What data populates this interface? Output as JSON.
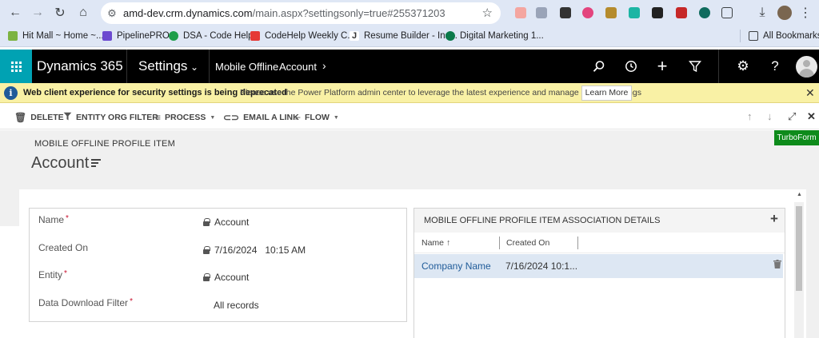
{
  "browser": {
    "url_host": "amd-dev.crm.dynamics.com",
    "url_path": "/main.aspx?settingsonly=true#255371203",
    "bookmarks": [
      {
        "label": "Hit Mall ~ Home ~...",
        "color": "#7cb342"
      },
      {
        "label": "PipelinePRO",
        "color": "#6c4ad0"
      },
      {
        "label": "DSA - Code Help",
        "color": "#1e9e4a"
      },
      {
        "label": "CodeHelp Weekly C...",
        "color": "#e53935"
      },
      {
        "label": "Resume Builder - Ins...",
        "color": "#333333"
      },
      {
        "label": "Digital Marketing 1...",
        "color": "#0b7a4b"
      }
    ],
    "all_bookmarks": "All Bookmarks"
  },
  "navbar": {
    "app_name": "Dynamics 365",
    "area": "Settings",
    "crumb_area": "Mobile Offline",
    "crumb_entity": "Account"
  },
  "notification": {
    "title": "Web client experience for security settings is being deprecated",
    "message": "Please use the Power Platform admin center to leverage the latest experience and manage security settings",
    "button": "Learn More"
  },
  "commands": {
    "delete": "DELETE",
    "entity_org_filter": "ENTITY ORG FILTER",
    "process": "PROCESS",
    "email_link": "EMAIL A LINK",
    "flow": "FLOW"
  },
  "header": {
    "entity_label": "MOBILE OFFLINE PROFILE ITEM",
    "record_title": "Account",
    "turboform": "TurboForm"
  },
  "fields": [
    {
      "label": "Name",
      "required": true,
      "value": "Account",
      "locked": true
    },
    {
      "label": "Created On",
      "required": false,
      "value": "7/16/2024   10:15 AM",
      "locked": true
    },
    {
      "label": "Entity",
      "required": true,
      "value": "Account",
      "locked": true
    },
    {
      "label": "Data Download Filter",
      "required": true,
      "value": "All records",
      "locked": false
    }
  ],
  "subgrid": {
    "title": "MOBILE OFFLINE PROFILE ITEM ASSOCIATION DETAILS",
    "columns": [
      "Name",
      "Created On"
    ],
    "sort_indicator": "↑",
    "rows": [
      {
        "name": "Company Name",
        "created_on": "7/16/2024 10:1..."
      }
    ]
  }
}
